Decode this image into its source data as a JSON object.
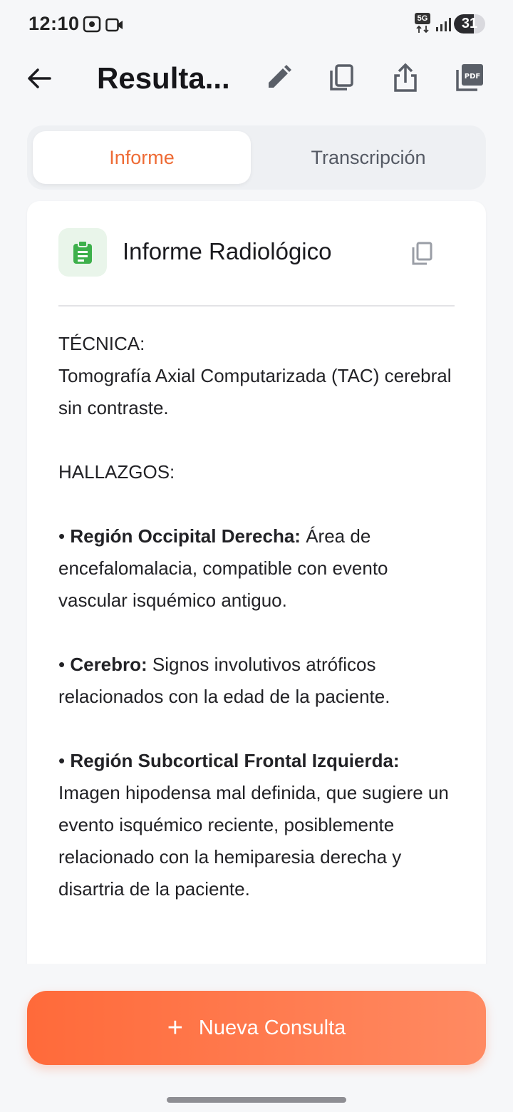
{
  "status_bar": {
    "time": "12:10",
    "network": "5G",
    "battery": "31"
  },
  "header": {
    "title": "Resulta...",
    "icons": [
      "back-arrow-icon",
      "edit-pencil-icon",
      "copy-icon",
      "share-icon",
      "pdf-icon"
    ]
  },
  "tabs": [
    {
      "label": "Informe",
      "active": true
    },
    {
      "label": "Transcripción",
      "active": false
    }
  ],
  "card": {
    "title": "Informe Radiológico",
    "sections": {
      "tecnica_heading": "TÉCNICA:",
      "tecnica_text": "Tomografía Axial Computarizada (TAC) cerebral sin contraste.",
      "hallazgos_heading": "HALLAZGOS:",
      "items": [
        {
          "label": "Región Occipital Derecha:",
          "text": "Área de encefalomalacia, compatible con evento vascular isquémico antiguo."
        },
        {
          "label": "Cerebro:",
          "text": "Signos involutivos atróficos relacionados con la edad de la paciente."
        },
        {
          "label": "Región Subcortical Frontal Izquierda:",
          "text": "Imagen hipodensa mal definida, que sugiere un evento isquémico reciente, posiblemente relacionado con la hemiparesia derecha y disartria de la paciente."
        }
      ]
    }
  },
  "actions": {
    "new_consult_label": "Nueva Consulta"
  },
  "colors": {
    "accent": "#ee6b35",
    "button_gradient_start": "#ff6a3a",
    "button_gradient_end": "#ff8a62",
    "badge_green": "#3db04b"
  }
}
